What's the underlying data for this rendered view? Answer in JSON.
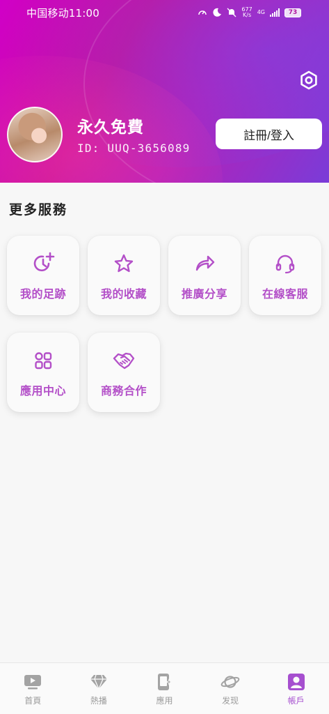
{
  "status_bar": {
    "carrier_time": "中国移动11:00",
    "net_speed_value": "677",
    "net_speed_unit": "K/s",
    "network_type": "4G",
    "battery": "73"
  },
  "profile": {
    "name": "永久免費",
    "id_text": "ID: UUQ-3656089",
    "login_button": "註冊/登入",
    "settings_icon": "gear-icon"
  },
  "services": {
    "title": "更多服務",
    "items": [
      {
        "label": "我的足跡",
        "icon": "history-clock-icon"
      },
      {
        "label": "我的收藏",
        "icon": "star-icon"
      },
      {
        "label": "推廣分享",
        "icon": "share-arrow-icon"
      },
      {
        "label": "在線客服",
        "icon": "headset-icon"
      },
      {
        "label": "應用中心",
        "icon": "apps-grid-icon"
      },
      {
        "label": "商務合作",
        "icon": "handshake-icon"
      }
    ]
  },
  "bottom_nav": {
    "items": [
      {
        "label": "首頁",
        "icon": "play-screen-icon",
        "active": false
      },
      {
        "label": "熱播",
        "icon": "diamond-icon",
        "active": false
      },
      {
        "label": "應用",
        "icon": "phone-app-icon",
        "active": false
      },
      {
        "label": "发现",
        "icon": "planet-icon",
        "active": false
      },
      {
        "label": "帳戶",
        "icon": "user-account-icon",
        "active": true
      }
    ]
  },
  "colors": {
    "accent": "#b34fc8",
    "active_nav": "#a64fcf",
    "inactive_nav": "#9b9b9b"
  }
}
